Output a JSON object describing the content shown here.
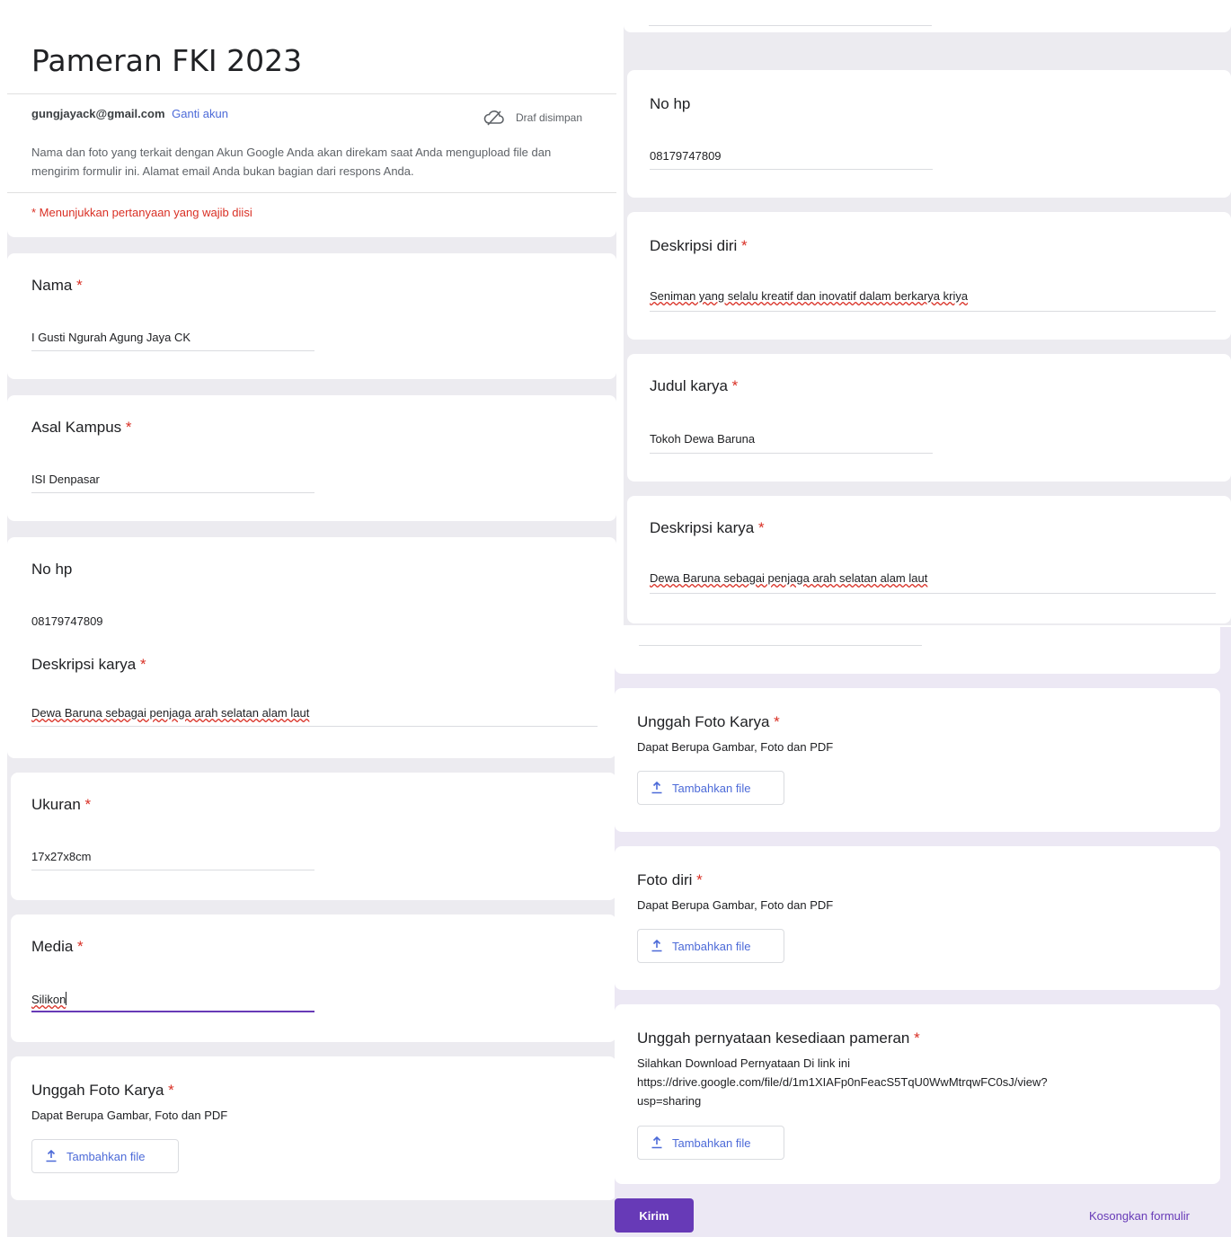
{
  "form": {
    "title": "Pameran FKI 2023",
    "account_email": "gungjayack@gmail.com",
    "switch_account": "Ganti akun",
    "draft_status": "Draf disimpan",
    "notice": "Nama dan foto yang terkait dengan Akun Google Anda akan direkam saat Anda mengupload file dan mengirim formulir ini. Alamat email Anda bukan bagian dari respons Anda.",
    "required_note": "* Menunjukkan pertanyaan yang wajib diisi"
  },
  "questions": {
    "nama": {
      "label": "Nama",
      "required_mark": "*",
      "value": "I Gusti Ngurah Agung Jaya CK"
    },
    "asal_kampus": {
      "label": "Asal Kampus",
      "required_mark": "*",
      "value": "ISI Denpasar"
    },
    "no_hp": {
      "label": "No hp",
      "value": "08179747809"
    },
    "deskripsi_diri": {
      "label": "Deskripsi diri",
      "required_mark": "*",
      "value": "Seniman yang selalu kreatif dan inovatif dalam berkarya kriya"
    },
    "judul_karya": {
      "label": "Judul karya",
      "required_mark": "*",
      "value": "Tokoh Dewa Baruna"
    },
    "deskripsi_karya": {
      "label": "Deskripsi karya",
      "required_mark": "*",
      "value": "Dewa Baruna sebagai penjaga arah selatan alam laut"
    },
    "ukuran": {
      "label": "Ukuran",
      "required_mark": "*",
      "value": "17x27x8cm"
    },
    "media": {
      "label": "Media",
      "required_mark": "*",
      "value": "Silikon"
    },
    "unggah_foto_karya": {
      "label": "Unggah Foto Karya",
      "required_mark": "*",
      "helper": "Dapat Berupa Gambar, Foto dan PDF",
      "button": "Tambahkan file"
    },
    "foto_diri": {
      "label": "Foto diri",
      "required_mark": "*",
      "helper": "Dapat Berupa Gambar, Foto dan PDF",
      "button": "Tambahkan file"
    },
    "pernyataan": {
      "label": "Unggah pernyataan kesediaan pameran",
      "required_mark": "*",
      "helper_line1": "Silahkan Download Pernyataan Di link ini",
      "helper_line2": "https://drive.google.com/file/d/1m1XIAFp0nFeacS5TqU0WwMtrqwFC0sJ/view?",
      "helper_line3": "usp=sharing",
      "button": "Tambahkan file"
    }
  },
  "actions": {
    "submit": "Kirim",
    "clear": "Kosongkan formulir"
  },
  "colors": {
    "accent": "#673ab7",
    "required": "#d93025",
    "link": "#4c6ad8",
    "background": "#ecebf0"
  },
  "icons": [
    "cloud-saved-icon",
    "upload-icon"
  ]
}
